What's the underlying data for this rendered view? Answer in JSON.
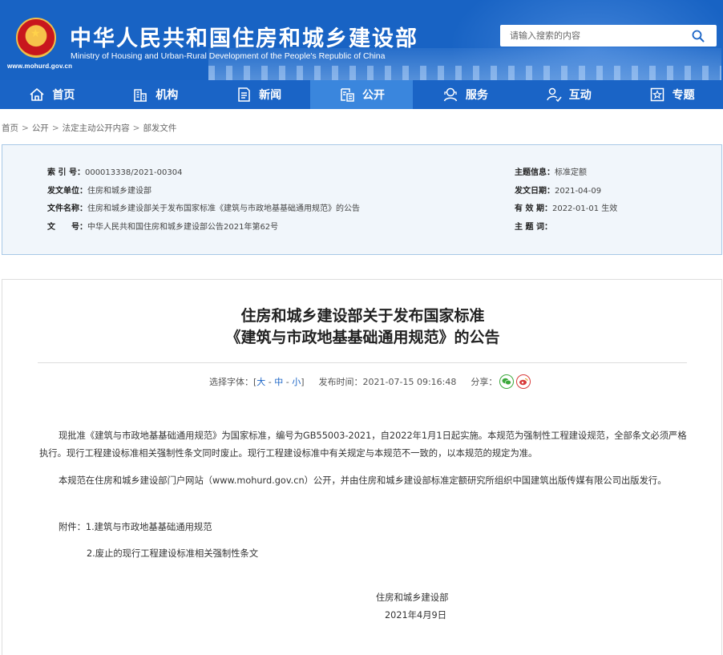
{
  "header": {
    "ministry_cn": "中华人民共和国住房和城乡建设部",
    "ministry_en": "Ministry of Housing and Urban-Rural Development of the People's Republic of China",
    "site_url": "www.mohurd.gov.cn",
    "search_placeholder": "请输入搜索的内容",
    "brand_color": "#1863c4"
  },
  "nav": {
    "items": [
      {
        "label": "首页",
        "icon": "home-icon"
      },
      {
        "label": "机构",
        "icon": "building-icon"
      },
      {
        "label": "新闻",
        "icon": "news-icon"
      },
      {
        "label": "公开",
        "icon": "disclosure-icon",
        "active": true
      },
      {
        "label": "服务",
        "icon": "service-icon"
      },
      {
        "label": "互动",
        "icon": "interaction-icon"
      },
      {
        "label": "专题",
        "icon": "topic-icon"
      }
    ]
  },
  "breadcrumb": [
    "首页",
    "公开",
    "法定主动公开内容",
    "部发文件"
  ],
  "info": {
    "index_no_label": "索 引 号：",
    "index_no": "000013338/2021-00304",
    "issuer_label": "发文单位：",
    "issuer": "住房和城乡建设部",
    "doc_name_label": "文件名称：",
    "doc_name": "住房和城乡建设部关于发布国家标准《建筑与市政地基基础通用规范》的公告",
    "doc_no_label": "文　　号：",
    "doc_no": "中华人民共和国住房和城乡建设部公告2021年第62号",
    "subject_label": "主题信息：",
    "subject": "标准定额",
    "date_label": "发文日期：",
    "date": "2021-04-09",
    "validity_label": "有 效 期：",
    "validity": "2022-01-01 生效",
    "keywords_label": "主 题 词：",
    "keywords": ""
  },
  "article": {
    "title_line1": "住房和城乡建设部关于发布国家标准",
    "title_line2": "《建筑与市政地基基础通用规范》的公告",
    "font_label": "选择字体：",
    "font_open": "[",
    "font_large": "大",
    "font_medium": "中",
    "font_small": "小",
    "font_close": "]",
    "font_sep": " - ",
    "publish_label": "发布时间：",
    "publish_time": "2021-07-15 09:16:48",
    "share_label": "分享：",
    "para1": "现批准《建筑与市政地基基础通用规范》为国家标准，编号为GB55003-2021，自2022年1月1日起实施。本规范为强制性工程建设规范，全部条文必须严格执行。现行工程建设标准相关强制性条文同时废止。现行工程建设标准中有关规定与本规范不一致的，以本规范的规定为准。",
    "para2": "本规范在住房和城乡建设部门户网站（www.mohurd.gov.cn）公开，并由住房和城乡建设部标准定额研究所组织中国建筑出版传媒有限公司出版发行。",
    "attachment1": "附件：1.建筑与市政地基基础通用规范",
    "attachment2": "2.废止的现行工程建设标准相关强制性条文",
    "signature": "住房和城乡建设部",
    "sign_date": "2021年4月9日"
  }
}
